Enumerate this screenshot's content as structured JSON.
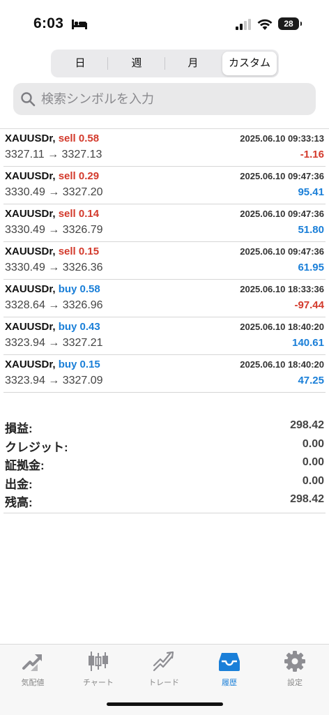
{
  "status": {
    "time": "6:03",
    "battery": "28"
  },
  "tabs": [
    {
      "label": "日",
      "selected": false
    },
    {
      "label": "週",
      "selected": false
    },
    {
      "label": "月",
      "selected": false
    },
    {
      "label": "カスタム",
      "selected": true
    }
  ],
  "search": {
    "placeholder": "検索シンボルを入力"
  },
  "trades": [
    {
      "symbol": "XAUUSDr,",
      "side": "sell 0.58",
      "datetime": "2025.06.10 09:33:13",
      "prices": "3327.11 → 3327.13",
      "profit": "-1.16"
    },
    {
      "symbol": "XAUUSDr,",
      "side": "sell 0.29",
      "datetime": "2025.06.10 09:47:36",
      "prices": "3330.49 → 3327.20",
      "profit": "95.41"
    },
    {
      "symbol": "XAUUSDr,",
      "side": "sell 0.14",
      "datetime": "2025.06.10 09:47:36",
      "prices": "3330.49 → 3326.79",
      "profit": "51.80"
    },
    {
      "symbol": "XAUUSDr,",
      "side": "sell 0.15",
      "datetime": "2025.06.10 09:47:36",
      "prices": "3330.49 → 3326.36",
      "profit": "61.95"
    },
    {
      "symbol": "XAUUSDr,",
      "side": "buy 0.58",
      "datetime": "2025.06.10 18:33:36",
      "prices": "3328.64 → 3326.96",
      "profit": "-97.44"
    },
    {
      "symbol": "XAUUSDr,",
      "side": "buy 0.43",
      "datetime": "2025.06.10 18:40:20",
      "prices": "3323.94 → 3327.21",
      "profit": "140.61"
    },
    {
      "symbol": "XAUUSDr,",
      "side": "buy 0.15",
      "datetime": "2025.06.10 18:40:20",
      "prices": "3323.94 → 3327.09",
      "profit": "47.25"
    }
  ],
  "summary": [
    {
      "label": "損益:",
      "value": "298.42"
    },
    {
      "label": "クレジット:",
      "value": "0.00"
    },
    {
      "label": "証拠金:",
      "value": "0.00"
    },
    {
      "label": "出金:",
      "value": "0.00"
    },
    {
      "label": "残高:",
      "value": "298.42"
    }
  ],
  "tabbar": [
    {
      "label": "気配値",
      "icon": "quotes-icon",
      "active": false
    },
    {
      "label": "チャート",
      "icon": "chart-icon",
      "active": false
    },
    {
      "label": "トレード",
      "icon": "trade-icon",
      "active": false
    },
    {
      "label": "履歴",
      "icon": "history-icon",
      "active": true
    },
    {
      "label": "設定",
      "icon": "settings-icon",
      "active": false
    }
  ],
  "colors": {
    "sell": "#d33a2c",
    "buy": "#1a7fd8",
    "accent": "#1a7fd8"
  }
}
